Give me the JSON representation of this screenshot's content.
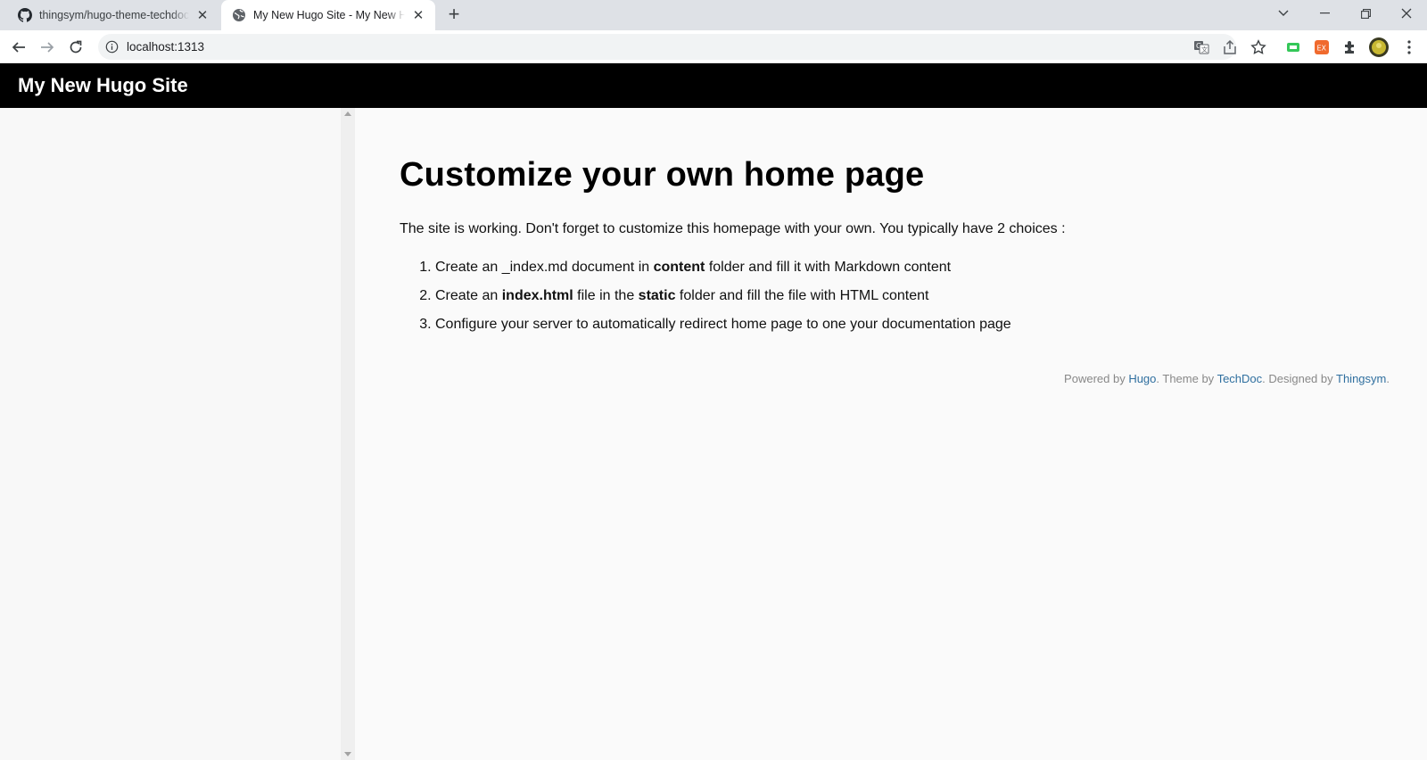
{
  "browser": {
    "tabs": [
      {
        "title": "thingsym/hugo-theme-techdoc",
        "favicon": "github-icon",
        "active": false
      },
      {
        "title": "My New Hugo Site - My New Hugo Site",
        "favicon": "globe-icon",
        "active": true
      }
    ],
    "address": "localhost:1313"
  },
  "site": {
    "title": "My New Hugo Site"
  },
  "page": {
    "heading": "Customize your own home page",
    "intro": "The site is working. Don't forget to customize this homepage with your own. You typically have 2 choices :",
    "choices": [
      {
        "a": "Create an _index.md document in ",
        "b": "content",
        "c": " folder and fill it with Markdown content",
        "d": "",
        "e": ""
      },
      {
        "a": "Create an ",
        "b": "index.html",
        "c": " file in the ",
        "d": "static",
        "e": " folder and fill the file with HTML content"
      },
      {
        "a": "Configure your server to automatically redirect home page to one your documentation page",
        "b": "",
        "c": "",
        "d": "",
        "e": ""
      }
    ],
    "footer": {
      "powered_by": "Powered by ",
      "hugo": "Hugo",
      "theme_by": ". Theme by ",
      "techdoc": "TechDoc",
      "designed_by": ". Designed by ",
      "thingsym": "Thingsym",
      "end": "."
    }
  },
  "colors": {
    "header_bg": "#000000",
    "link": "#2f6f9f",
    "footer_text": "#888888"
  }
}
